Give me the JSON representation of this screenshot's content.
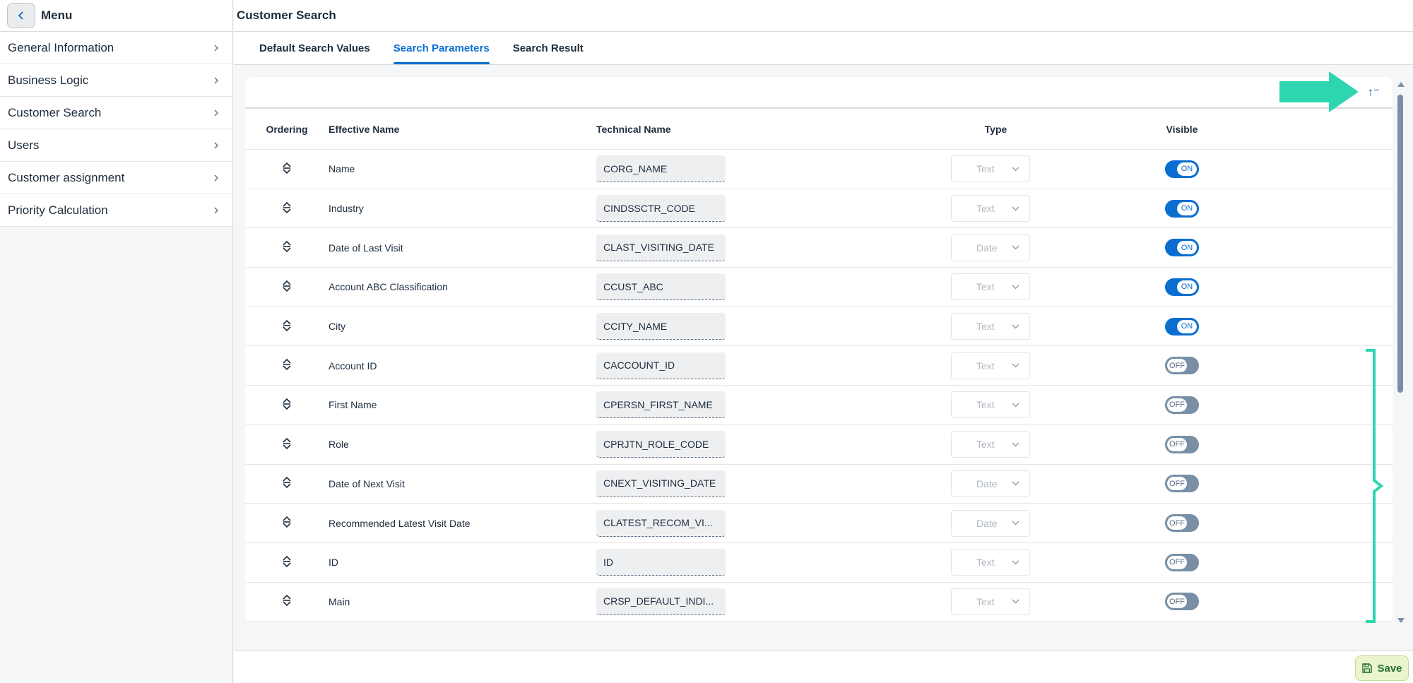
{
  "sidebar": {
    "title": "Menu",
    "items": [
      {
        "label": "General Information"
      },
      {
        "label": "Business Logic"
      },
      {
        "label": "Customer Search"
      },
      {
        "label": "Users"
      },
      {
        "label": "Customer assignment"
      },
      {
        "label": "Priority Calculation"
      }
    ]
  },
  "header": {
    "title": "Customer Search"
  },
  "tabs": [
    {
      "label": "Default Search Values"
    },
    {
      "label": "Search Parameters"
    },
    {
      "label": "Search Result"
    }
  ],
  "table": {
    "sort_icon": "↑⁻",
    "columns": {
      "ordering": "Ordering",
      "effective_name": "Effective Name",
      "technical_name": "Technical Name",
      "type": "Type",
      "visible": "Visible"
    },
    "rows": [
      {
        "effective": "Name",
        "technical": "CORG_NAME",
        "type": "Text",
        "visible": "ON"
      },
      {
        "effective": "Industry",
        "technical": "CINDSSCTR_CODE",
        "type": "Text",
        "visible": "ON"
      },
      {
        "effective": "Date of Last Visit",
        "technical": "CLAST_VISITING_DATE",
        "type": "Date",
        "visible": "ON"
      },
      {
        "effective": "Account ABC Classification",
        "technical": "CCUST_ABC",
        "type": "Text",
        "visible": "ON"
      },
      {
        "effective": "City",
        "technical": "CCITY_NAME",
        "type": "Text",
        "visible": "ON"
      },
      {
        "effective": "Account ID",
        "technical": "CACCOUNT_ID",
        "type": "Text",
        "visible": "OFF"
      },
      {
        "effective": "First Name",
        "technical": "CPERSN_FIRST_NAME",
        "type": "Text",
        "visible": "OFF"
      },
      {
        "effective": "Role",
        "technical": "CPRJTN_ROLE_CODE",
        "type": "Text",
        "visible": "OFF"
      },
      {
        "effective": "Date of Next Visit",
        "technical": "CNEXT_VISITING_DATE",
        "type": "Date",
        "visible": "OFF"
      },
      {
        "effective": "Recommended Latest Visit Date",
        "technical": "CLATEST_RECOM_VI...",
        "type": "Date",
        "visible": "OFF"
      },
      {
        "effective": "ID",
        "technical": "ID",
        "type": "Text",
        "visible": "OFF"
      },
      {
        "effective": "Main",
        "technical": "CRSP_DEFAULT_INDI...",
        "type": "Text",
        "visible": "OFF"
      }
    ]
  },
  "footer": {
    "save_label": "Save"
  },
  "colors": {
    "accent": "#0a6ed1",
    "annotation": "#2ed6b0",
    "save_bg": "#ebf5cb"
  }
}
